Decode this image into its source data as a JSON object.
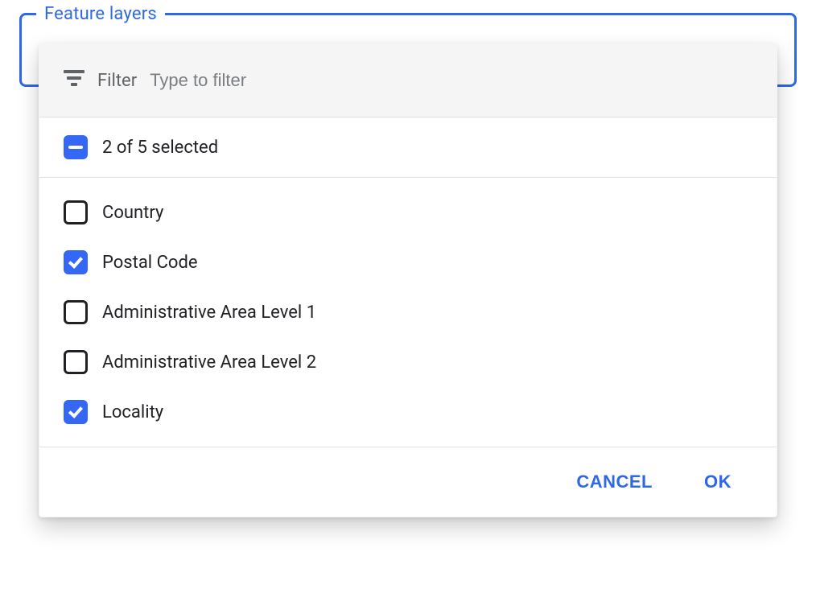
{
  "fieldset": {
    "legend": "Feature layers"
  },
  "filter": {
    "label": "Filter",
    "placeholder": "Type to filter",
    "value": ""
  },
  "selectAll": {
    "summary": "2 of 5 selected"
  },
  "options": [
    {
      "label": "Country",
      "checked": false
    },
    {
      "label": "Postal Code",
      "checked": true
    },
    {
      "label": "Administrative Area Level 1",
      "checked": false
    },
    {
      "label": "Administrative Area Level 2",
      "checked": false
    },
    {
      "label": "Locality",
      "checked": true
    }
  ],
  "buttons": {
    "cancel": "CANCEL",
    "ok": "OK"
  },
  "colors": {
    "accent": "#2F68E6",
    "checkbox_fill": "#3367F4",
    "muted_text": "#5f6368"
  }
}
